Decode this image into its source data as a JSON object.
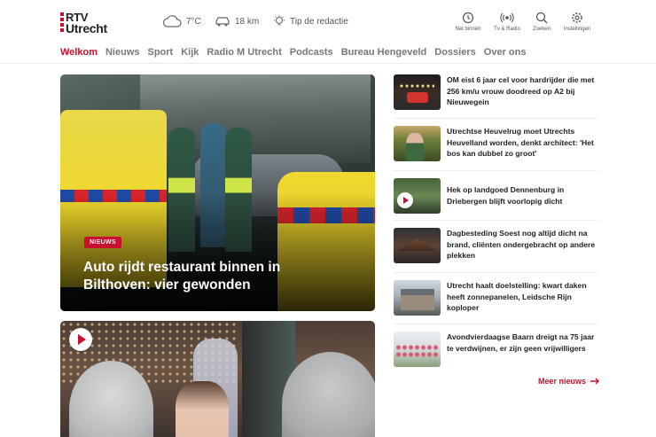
{
  "brand": {
    "line1": "RTV",
    "line2": "Utrecht",
    "accent": "#c8102e"
  },
  "header": {
    "weather": {
      "icon": "cloud-icon",
      "value": "7°C"
    },
    "traffic": {
      "icon": "car-icon",
      "value": "18 km"
    },
    "tip": {
      "icon": "lightbulb-icon",
      "label": "Tip de redactie"
    },
    "tools": [
      {
        "icon": "clock-icon",
        "label": "Net binnen"
      },
      {
        "icon": "radio-icon",
        "label": "Tv & Radio"
      },
      {
        "icon": "search-icon",
        "label": "Zoeken"
      },
      {
        "icon": "gear-icon",
        "label": "Instellingen"
      }
    ]
  },
  "nav": {
    "items": [
      "Welkom",
      "Nieuws",
      "Sport",
      "Kijk",
      "Radio M Utrecht",
      "Podcasts",
      "Bureau Hengeveld",
      "Dossiers",
      "Over ons"
    ],
    "active_index": 0
  },
  "hero": {
    "badge": "NIEUWS",
    "title": "Auto rijdt restaurant binnen in Bilthoven: vier gewonden"
  },
  "second_card": {
    "has_video": true
  },
  "news_list": [
    {
      "title": "OM eist 6 jaar cel voor hardrijder die met 256 km/u vrouw doodreed op A2 bij Nieuwegein",
      "video": false
    },
    {
      "title": "Utrechtse Heuvelrug moet Utrechts Heuvelland worden, denkt architect: 'Het bos kan dubbel zo groot'",
      "video": false
    },
    {
      "title": "Hek op landgoed Dennenburg in Driebergen blijft voorlopig dicht",
      "video": true
    },
    {
      "title": "Dagbesteding Soest nog altijd dicht na brand, cliënten ondergebracht op andere plekken",
      "video": false
    },
    {
      "title": "Utrecht haalt doelstelling: kwart daken heeft zonnepanelen, Leidsche Rijn koploper",
      "video": false
    },
    {
      "title": "Avondvierdaagse Baarn dreigt na 75 jaar te verdwijnen, er zijn geen vrijwilligers",
      "video": false
    }
  ],
  "more_news": {
    "label": "Meer nieuws",
    "icon": "arrow-right-icon"
  }
}
